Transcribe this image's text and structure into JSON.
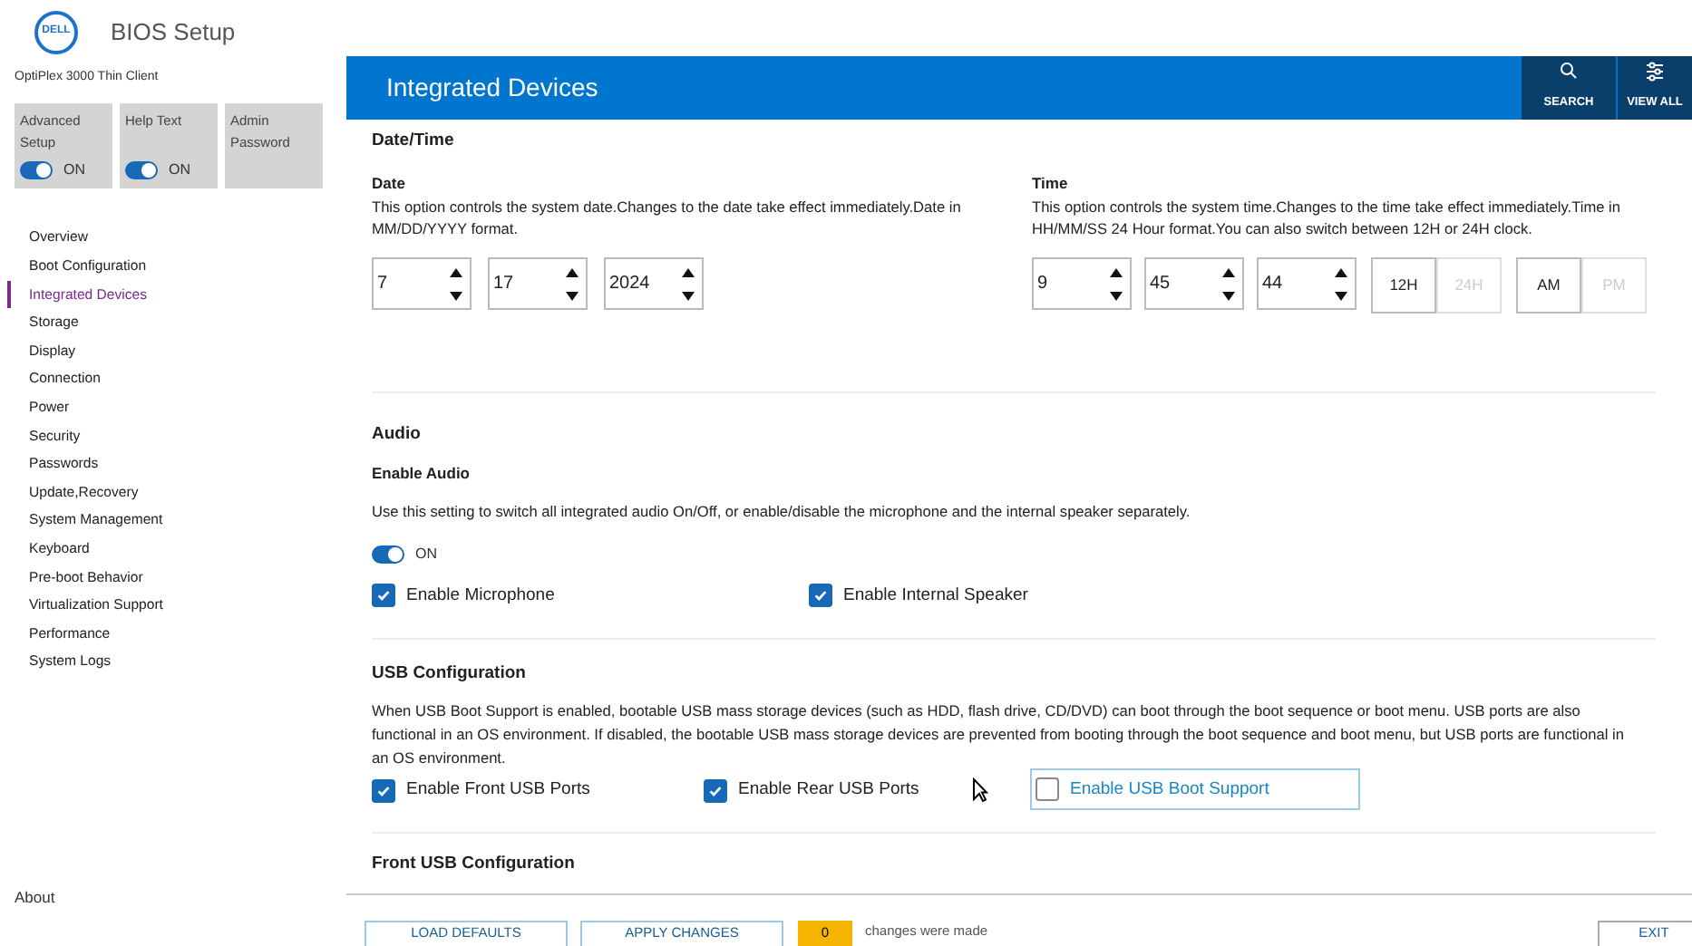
{
  "logo": "DELL",
  "app_title": "BIOS Setup",
  "model": "OptiPlex 3000 Thin Client",
  "quick_tiles": [
    {
      "label": "Advanced Setup",
      "kind": "toggle",
      "on": true,
      "state_label": "ON"
    },
    {
      "label": "Help Text",
      "kind": "toggle",
      "on": true,
      "state_label": "ON"
    },
    {
      "label": "Admin Password",
      "kind": "plain"
    }
  ],
  "nav": [
    {
      "label": "Overview",
      "selected": false
    },
    {
      "label": "Boot Configuration",
      "selected": false
    },
    {
      "label": "Integrated Devices",
      "selected": true
    },
    {
      "label": "Storage",
      "selected": false
    },
    {
      "label": "Display",
      "selected": false
    },
    {
      "label": "Connection",
      "selected": false
    },
    {
      "label": "Power",
      "selected": false
    },
    {
      "label": "Security",
      "selected": false
    },
    {
      "label": "Passwords",
      "selected": false
    },
    {
      "label": "Update,Recovery",
      "selected": false
    },
    {
      "label": "System Management",
      "selected": false
    },
    {
      "label": "Keyboard",
      "selected": false
    },
    {
      "label": "Pre-boot Behavior",
      "selected": false
    },
    {
      "label": "Virtualization Support",
      "selected": false
    },
    {
      "label": "Performance",
      "selected": false
    },
    {
      "label": "System Logs",
      "selected": false
    }
  ],
  "about": "About",
  "header": {
    "title": "Integrated Devices",
    "actions": [
      {
        "kind": "search",
        "label": "SEARCH"
      },
      {
        "kind": "view_all",
        "label": "VIEW ALL"
      }
    ]
  },
  "date_time": {
    "title": "Date/Time",
    "date": {
      "label": "Date",
      "description": "This option controls the system date.Changes to the date take effect immediately.Date in MM/DD/YYYY format.",
      "fields": [
        "7",
        "17",
        "2024"
      ]
    },
    "time": {
      "label": "Time",
      "description": "This option controls the system time.Changes to the time take effect immediately.Time in HH/MM/SS 24 Hour format.You can also switch between 12H or 24H clock.",
      "fields": [
        "9",
        "45",
        "44"
      ],
      "clock": [
        {
          "label": "12H",
          "selected": true
        },
        {
          "label": "24H",
          "selected": false
        }
      ],
      "meridiem": [
        {
          "label": "AM",
          "selected": true
        },
        {
          "label": "PM",
          "selected": false
        }
      ]
    }
  },
  "audio": {
    "title": "Audio",
    "setting_title": "Enable Audio",
    "description": "Use this setting to switch all integrated audio On/Off, or enable/disable the microphone and the internal speaker separately.",
    "toggle": {
      "on": true,
      "label": "ON"
    },
    "options": [
      {
        "label": "Enable Microphone",
        "checked": true
      },
      {
        "label": "Enable Internal Speaker",
        "checked": true
      }
    ]
  },
  "usb": {
    "title": "USB Configuration",
    "description": "When USB Boot Support is enabled, bootable USB mass storage devices (such as HDD, flash drive, CD/DVD) can boot through the boot sequence or boot menu. USB ports are also functional in an OS environment. If disabled, the bootable USB mass storage devices are prevented from booting through the boot sequence and boot menu, but USB ports are functional in an OS environment.",
    "options": [
      {
        "label": "Enable Front USB Ports",
        "checked": true,
        "focused": false
      },
      {
        "label": "Enable Rear USB Ports",
        "checked": true,
        "focused": false
      },
      {
        "label": "Enable USB Boot Support",
        "checked": false,
        "focused": true
      }
    ]
  },
  "next_section_title": "Front USB Configuration",
  "footer": {
    "buttons": [
      "LOAD DEFAULTS",
      "APPLY CHANGES"
    ],
    "count": "0",
    "count_note": "changes were made",
    "exit": "EXIT"
  }
}
